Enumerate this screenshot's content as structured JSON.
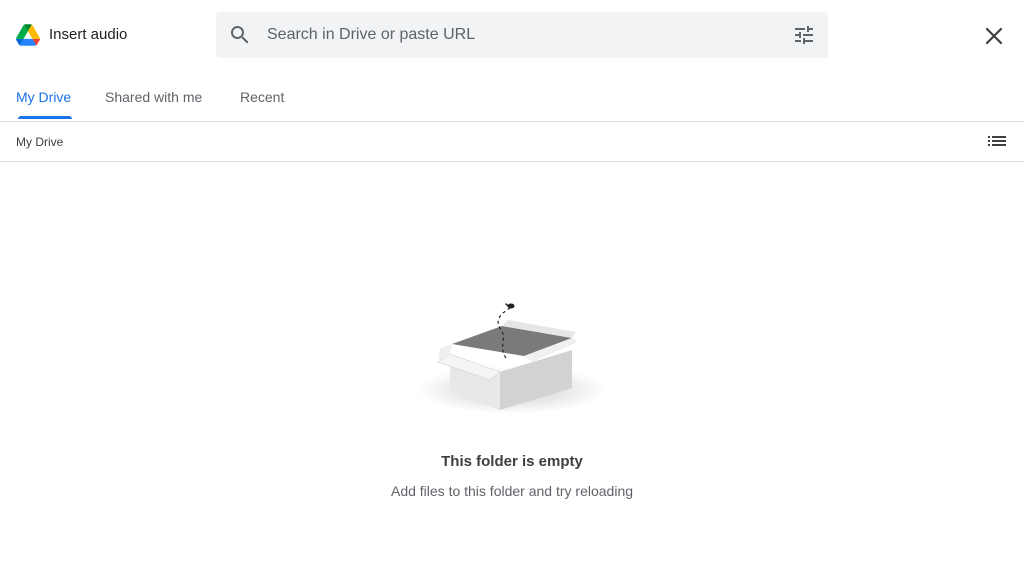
{
  "header": {
    "title": "Insert audio",
    "logo_icon": "google-drive-logo",
    "close_icon": "close-icon"
  },
  "search": {
    "placeholder": "Search in Drive or paste URL",
    "value": "",
    "search_icon": "search-icon",
    "filter_icon": "tune-icon"
  },
  "tabs": [
    {
      "label": "My Drive",
      "active": true
    },
    {
      "label": "Shared with me",
      "active": false
    },
    {
      "label": "Recent",
      "active": false
    }
  ],
  "breadcrumb": {
    "label": "My Drive",
    "view_icon": "list-view-icon"
  },
  "empty_state": {
    "title": "This folder is empty",
    "subtitle": "Add files to this folder and try reloading",
    "illustration": "empty-box-illustration"
  },
  "colors": {
    "accent": "#1a73e8",
    "search_bg": "#f1f3f4",
    "divider": "#dadce0"
  }
}
